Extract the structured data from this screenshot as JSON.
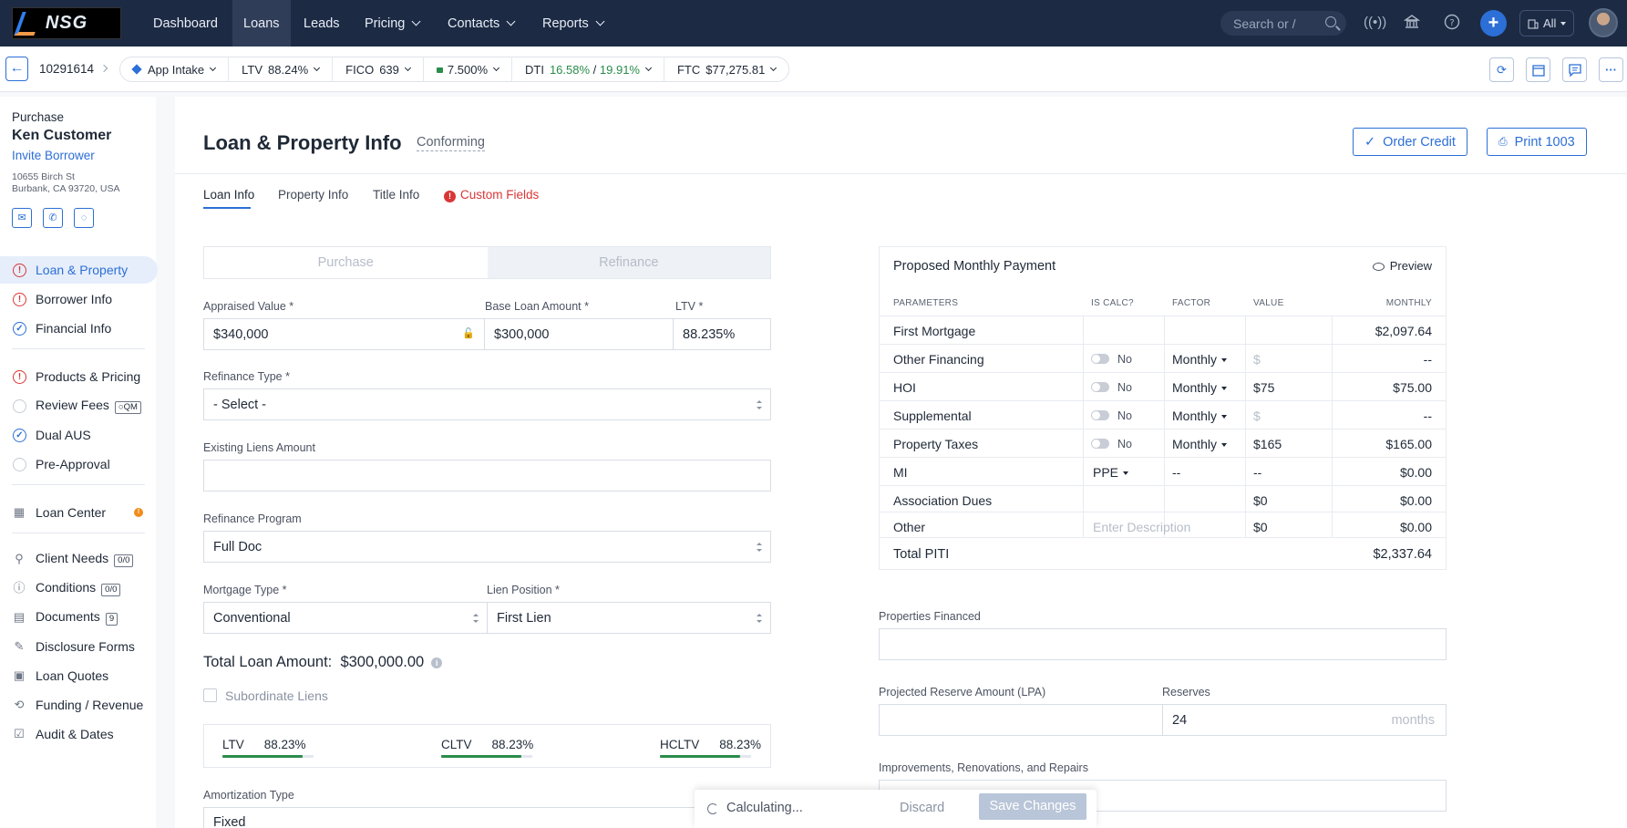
{
  "topnav": {
    "logo_text": "NSG",
    "items": [
      {
        "label": "Dashboard",
        "dropdown": false
      },
      {
        "label": "Loans",
        "dropdown": false
      },
      {
        "label": "Leads",
        "dropdown": false
      },
      {
        "label": "Pricing",
        "dropdown": true
      },
      {
        "label": "Contacts",
        "dropdown": true
      },
      {
        "label": "Reports",
        "dropdown": true
      }
    ],
    "search_placeholder": "Search or /",
    "scope_label": "All",
    "colors": {
      "bg": "#1c2a44",
      "accent": "#2c6fd6"
    }
  },
  "subbar": {
    "loan_number": "10291614",
    "chips": {
      "stage": "App Intake",
      "ltv_label": "LTV",
      "ltv_value": "88.24%",
      "fico_label": "FICO",
      "fico_value": "639",
      "rate_value": "7.500%",
      "dti_label": "DTI",
      "dti_front": "16.58%",
      "dti_sep": " / ",
      "dti_back": "19.91%",
      "ftc_label": "FTC",
      "ftc_value": "$77,275.81"
    }
  },
  "borrower": {
    "purpose": "Purchase",
    "name": "Ken Customer",
    "invite": "Invite Borrower",
    "address1": "10655 Birch St",
    "address2": "Burbank, CA 93720, USA"
  },
  "sidebar": {
    "loan_property": "Loan & Property",
    "borrower_info": "Borrower Info",
    "financial_info": "Financial Info",
    "products_pricing": "Products & Pricing",
    "review_fees": "Review Fees",
    "review_fees_badge": "QM",
    "dual_aus": "Dual AUS",
    "pre_approval": "Pre-Approval",
    "loan_center": "Loan Center",
    "client_needs": "Client Needs",
    "client_needs_badge": "0/0",
    "conditions": "Conditions",
    "conditions_badge": "0/0",
    "documents": "Documents",
    "documents_badge": "9",
    "disclosure_forms": "Disclosure Forms",
    "loan_quotes": "Loan Quotes",
    "funding_revenue": "Funding / Revenue",
    "audit_dates": "Audit & Dates"
  },
  "page": {
    "title": "Loan & Property Info",
    "subtitle": "Conforming",
    "order_credit": "Order Credit",
    "print": "Print 1003",
    "tabs": {
      "loan_info": "Loan Info",
      "property_info": "Property Info",
      "title_info": "Title Info",
      "custom_fields": "Custom Fields"
    }
  },
  "form": {
    "purpose_options": {
      "purchase": "Purchase",
      "refinance": "Refinance",
      "selected": "Refinance"
    },
    "appraised_label": "Appraised Value *",
    "appraised_value": "$340,000",
    "base_loan_label": "Base Loan Amount *",
    "base_loan_value": "$300,000",
    "ltv_label": "LTV *",
    "ltv_value": "88.235%",
    "refi_type_label": "Refinance Type *",
    "refi_type_value": "- Select -",
    "existing_liens_label": "Existing Liens Amount",
    "existing_liens_value": "",
    "refi_program_label": "Refinance Program",
    "refi_program_value": "Full Doc",
    "mortgage_type_label": "Mortgage Type *",
    "mortgage_type_value": "Conventional",
    "lien_position_label": "Lien Position *",
    "lien_position_value": "First Lien",
    "total_loan_label": "Total Loan Amount:",
    "total_loan_value": "$300,000.00",
    "subordinate_label": "Subordinate Liens",
    "ratios": [
      {
        "label": "LTV",
        "value": "88.23%",
        "pct": 0.8823
      },
      {
        "label": "CLTV",
        "value": "88.23%",
        "pct": 0.8823
      },
      {
        "label": "HCLTV",
        "value": "88.23%",
        "pct": 0.8823
      }
    ],
    "amortization_label": "Amortization Type",
    "amortization_value": "Fixed"
  },
  "payment": {
    "title": "Proposed Monthly Payment",
    "preview": "Preview",
    "headers": {
      "param": "PARAMETERS",
      "calc": "IS CALC?",
      "factor": "FACTOR",
      "value": "VALUE",
      "monthly": "MONTHLY"
    },
    "rows": [
      {
        "param": "First Mortgage",
        "calc": "",
        "factor": "",
        "value": "",
        "monthly": "$2,097.64"
      },
      {
        "param": "Other Financing",
        "calc": "No",
        "factor": "Monthly",
        "value": "$",
        "monthly": "--"
      },
      {
        "param": "HOI",
        "calc": "No",
        "factor": "Monthly",
        "value": "$75",
        "monthly": "$75.00"
      },
      {
        "param": "Supplemental",
        "calc": "No",
        "factor": "Monthly",
        "value": "$",
        "monthly": "--"
      },
      {
        "param": "Property Taxes",
        "calc": "No",
        "factor": "Monthly",
        "value": "$165",
        "monthly": "$165.00"
      },
      {
        "param": "MI",
        "calc": "PPE",
        "factor": "--",
        "value": "--",
        "monthly": "$0.00"
      },
      {
        "param": "Association Dues",
        "calc": "",
        "factor": "",
        "value": "$0",
        "monthly": "$0.00"
      },
      {
        "param": "Other",
        "calc": "Enter Description",
        "factor": "",
        "value": "$0",
        "monthly": "$0.00"
      }
    ],
    "total_label": "Total PITI",
    "total_value": "$2,337.64"
  },
  "right_form": {
    "properties_financed_label": "Properties Financed",
    "reserve_amount_label": "Projected Reserve Amount (LPA)",
    "reserves_label": "Reserves",
    "reserves_value": "24",
    "reserves_unit": "months",
    "improvements_label": "Improvements, Renovations, and Repairs"
  },
  "savebar": {
    "status": "Calculating...",
    "discard": "Discard",
    "save": "Save Changes"
  }
}
